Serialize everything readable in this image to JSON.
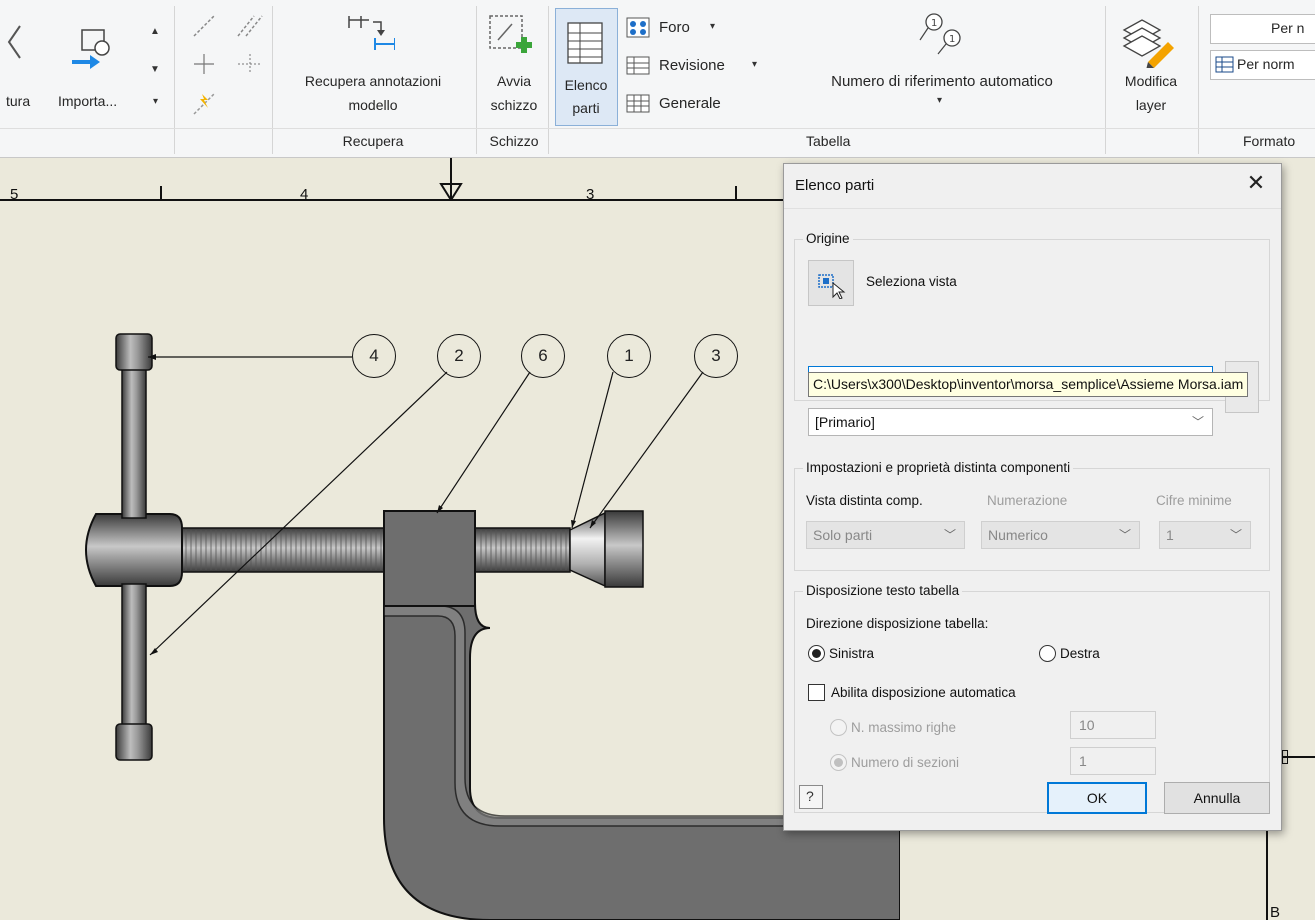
{
  "ribbon": {
    "partial_left": "tura",
    "import_label": "Importa...",
    "retrieve_button": [
      "Recupera annotazioni",
      "modello"
    ],
    "retrieve_group": "Recupera",
    "sketch_button": [
      "Avvia",
      "schizzo"
    ],
    "sketch_group": "Schizzo",
    "parts_list_button": [
      "Elenco",
      "parti"
    ],
    "hole_label": "Foro",
    "revision_label": "Revisione",
    "general_label": "Generale",
    "balloon_label": "Numero di riferimento automatico",
    "table_group": "Tabella",
    "modify_layer": [
      "Modifica",
      "layer"
    ],
    "format_partial_1": "Per n",
    "format_partial_2": "Per norm",
    "format_group": "Formato"
  },
  "drawing": {
    "ruler_labels": [
      "5",
      "4",
      "3"
    ],
    "balloons": [
      "4",
      "2",
      "6",
      "1",
      "3"
    ],
    "corner_letter": "B"
  },
  "dialog": {
    "title": "Elenco parti",
    "source_group": "Origine",
    "select_view": "Seleziona vista",
    "file_path": "C:\\Users\\x300\\Desktop\\inventor\\morsa_semplice\\Assieme Morsa.iam",
    "bom_combo": "[Primario]",
    "bom_group": "Impostazioni e proprietà distinta componenti",
    "bom_view_label": "Vista distinta comp.",
    "numbering_label": "Numerazione",
    "min_digits_label": "Cifre minime",
    "bom_view_value": "Solo parti",
    "numbering_value": "Numerico",
    "min_digits_value": "1",
    "wrap_group": "Disposizione testo tabella",
    "direction_label": "Direzione disposizione tabella:",
    "left": "Sinistra",
    "right": "Destra",
    "auto_wrap": "Abilita disposizione automatica",
    "max_rows": "N. massimo righe",
    "max_rows_value": "10",
    "sections": "Numero di sezioni",
    "sections_value": "1",
    "ok": "OK",
    "cancel": "Annulla"
  }
}
